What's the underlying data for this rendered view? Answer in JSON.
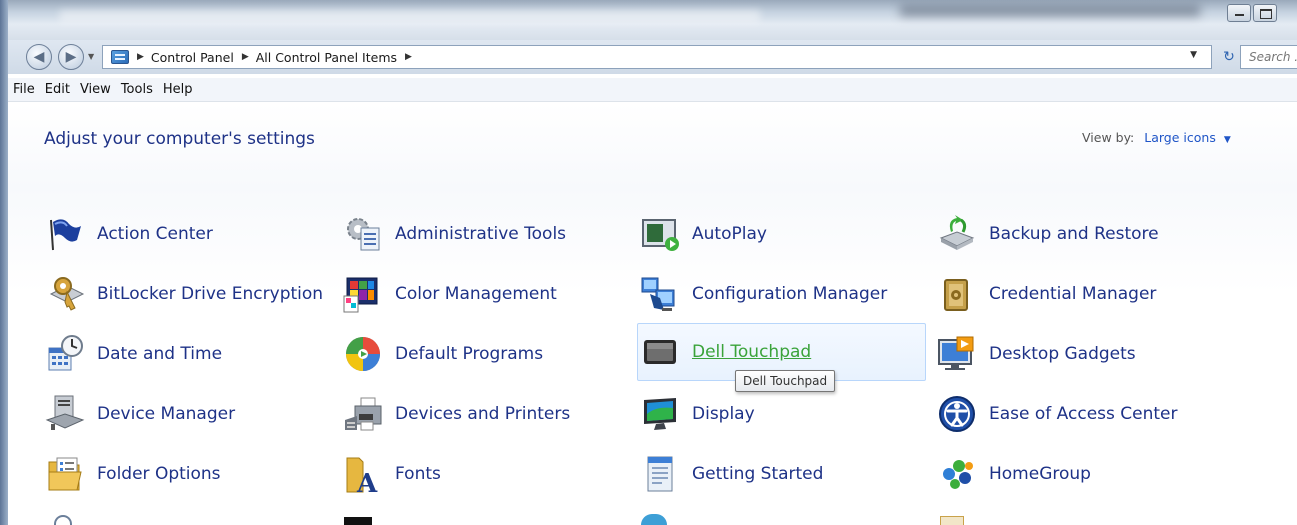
{
  "address": {
    "breadcrumbs": [
      "Control Panel",
      "All Control Panel Items"
    ],
    "search_placeholder": "Search ..."
  },
  "menu": [
    "File",
    "Edit",
    "View",
    "Tools",
    "Help"
  ],
  "header": {
    "title": "Adjust your computer's settings",
    "view_by_label": "View by:",
    "view_by_value": "Large icons"
  },
  "items": [
    {
      "label": "Action Center",
      "icon": "flag-icon"
    },
    {
      "label": "Administrative Tools",
      "icon": "admin-tools-icon"
    },
    {
      "label": "AutoPlay",
      "icon": "autoplay-icon"
    },
    {
      "label": "Backup and Restore",
      "icon": "backup-icon"
    },
    {
      "label": "BitLocker Drive Encryption",
      "icon": "bitlocker-icon"
    },
    {
      "label": "Color Management",
      "icon": "color-management-icon"
    },
    {
      "label": "Configuration Manager",
      "icon": "configuration-manager-icon"
    },
    {
      "label": "Credential Manager",
      "icon": "credential-manager-icon"
    },
    {
      "label": "Date and Time",
      "icon": "clock-calendar-icon"
    },
    {
      "label": "Default Programs",
      "icon": "default-programs-icon"
    },
    {
      "label": "Dell Touchpad",
      "icon": "touchpad-icon"
    },
    {
      "label": "Desktop Gadgets",
      "icon": "gadgets-icon"
    },
    {
      "label": "Device Manager",
      "icon": "device-manager-icon"
    },
    {
      "label": "Devices and Printers",
      "icon": "printer-icon"
    },
    {
      "label": "Display",
      "icon": "monitor-icon"
    },
    {
      "label": "Ease of Access Center",
      "icon": "ease-of-access-icon"
    },
    {
      "label": "Folder Options",
      "icon": "folder-options-icon"
    },
    {
      "label": "Fonts",
      "icon": "fonts-icon"
    },
    {
      "label": "Getting Started",
      "icon": "getting-started-icon"
    },
    {
      "label": "HomeGroup",
      "icon": "homegroup-icon"
    }
  ],
  "tooltip": "Dell Touchpad",
  "colors": {
    "link": "#1e3287",
    "hover_link": "#3aa33a",
    "accent": "#1f55c7"
  }
}
